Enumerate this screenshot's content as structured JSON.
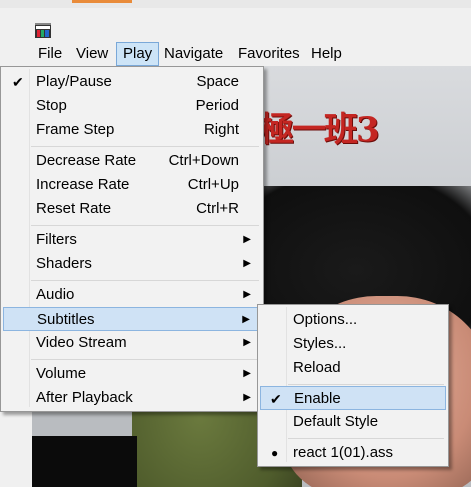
{
  "menubar": {
    "items": [
      {
        "label": "File"
      },
      {
        "label": "View"
      },
      {
        "label": "Play",
        "active": true
      },
      {
        "label": "Navigate"
      },
      {
        "label": "Favorites"
      },
      {
        "label": "Help"
      }
    ]
  },
  "video": {
    "title_text": "極一班3"
  },
  "play_menu": {
    "items": [
      {
        "label": "Play/Pause",
        "shortcut": "Space",
        "checked": true
      },
      {
        "label": "Stop",
        "shortcut": "Period"
      },
      {
        "label": "Frame Step",
        "shortcut": "Right"
      },
      {
        "label": "Decrease Rate",
        "shortcut": "Ctrl+Down"
      },
      {
        "label": "Increase Rate",
        "shortcut": "Ctrl+Up"
      },
      {
        "label": "Reset Rate",
        "shortcut": "Ctrl+R"
      },
      {
        "label": "Filters",
        "submenu": true
      },
      {
        "label": "Shaders",
        "submenu": true
      },
      {
        "label": "Audio",
        "submenu": true
      },
      {
        "label": "Subtitles",
        "submenu": true,
        "highlighted": true
      },
      {
        "label": "Video Stream",
        "submenu": true
      },
      {
        "label": "Volume",
        "submenu": true
      },
      {
        "label": "After Playback",
        "submenu": true
      }
    ]
  },
  "subtitles_menu": {
    "items": [
      {
        "label": "Options..."
      },
      {
        "label": "Styles..."
      },
      {
        "label": "Reload"
      },
      {
        "label": "Enable",
        "checked": true,
        "highlighted": true
      },
      {
        "label": "Default Style"
      },
      {
        "label": "react 1(01).ass",
        "selected": true
      }
    ]
  },
  "glyphs": {
    "check": "✔",
    "arrow": "▶",
    "bullet": "●"
  },
  "colors": {
    "highlight": "#cfe2f5",
    "menu_bg": "#f2f2f2",
    "active_menubar": "#cde4f7"
  }
}
